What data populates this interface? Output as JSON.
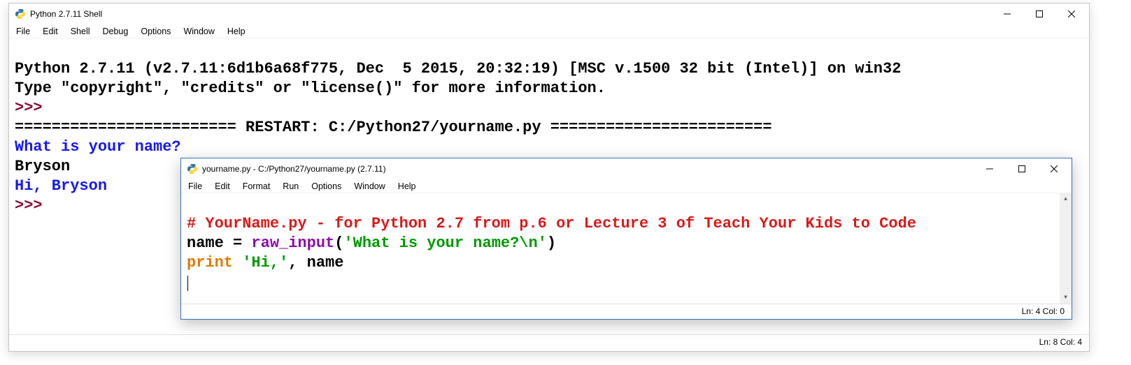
{
  "shell": {
    "title": "Python 2.7.11 Shell",
    "menus": [
      "File",
      "Edit",
      "Shell",
      "Debug",
      "Options",
      "Window",
      "Help"
    ],
    "banner1": "Python 2.7.11 (v2.7.11:6d1b6a68f775, Dec  5 2015, 20:32:19) [MSC v.1500 32 bit (Intel)] on win32",
    "banner2": "Type \"copyright\", \"credits\" or \"license()\" for more information.",
    "prompt1": ">>> ",
    "restart": "======================== RESTART: C:/Python27/yourname.py ========================",
    "out_prompt": "What is your name?",
    "user_input": "Bryson",
    "out_greeting": "Hi, Bryson",
    "prompt2": ">>> ",
    "status": "Ln: 8  Col: 4"
  },
  "editor": {
    "title": "yourname.py - C:/Python27/yourname.py (2.7.11)",
    "menus": [
      "File",
      "Edit",
      "Format",
      "Run",
      "Options",
      "Window",
      "Help"
    ],
    "line1_comment": "# YourName.py - for Python 2.7 from p.6 or Lecture 3 of Teach Your Kids to Code",
    "line2_a": "name = ",
    "line2_fn": "raw_input",
    "line2_paren_open": "(",
    "line2_str": "'What is your name?\\n'",
    "line2_paren_close": ")",
    "line3_kw": "print",
    "line3_sp": " ",
    "line3_str": "'Hi,'",
    "line3_rest": ", name",
    "status": "Ln: 4  Col: 0"
  },
  "icons": {
    "python": "python-logo"
  }
}
